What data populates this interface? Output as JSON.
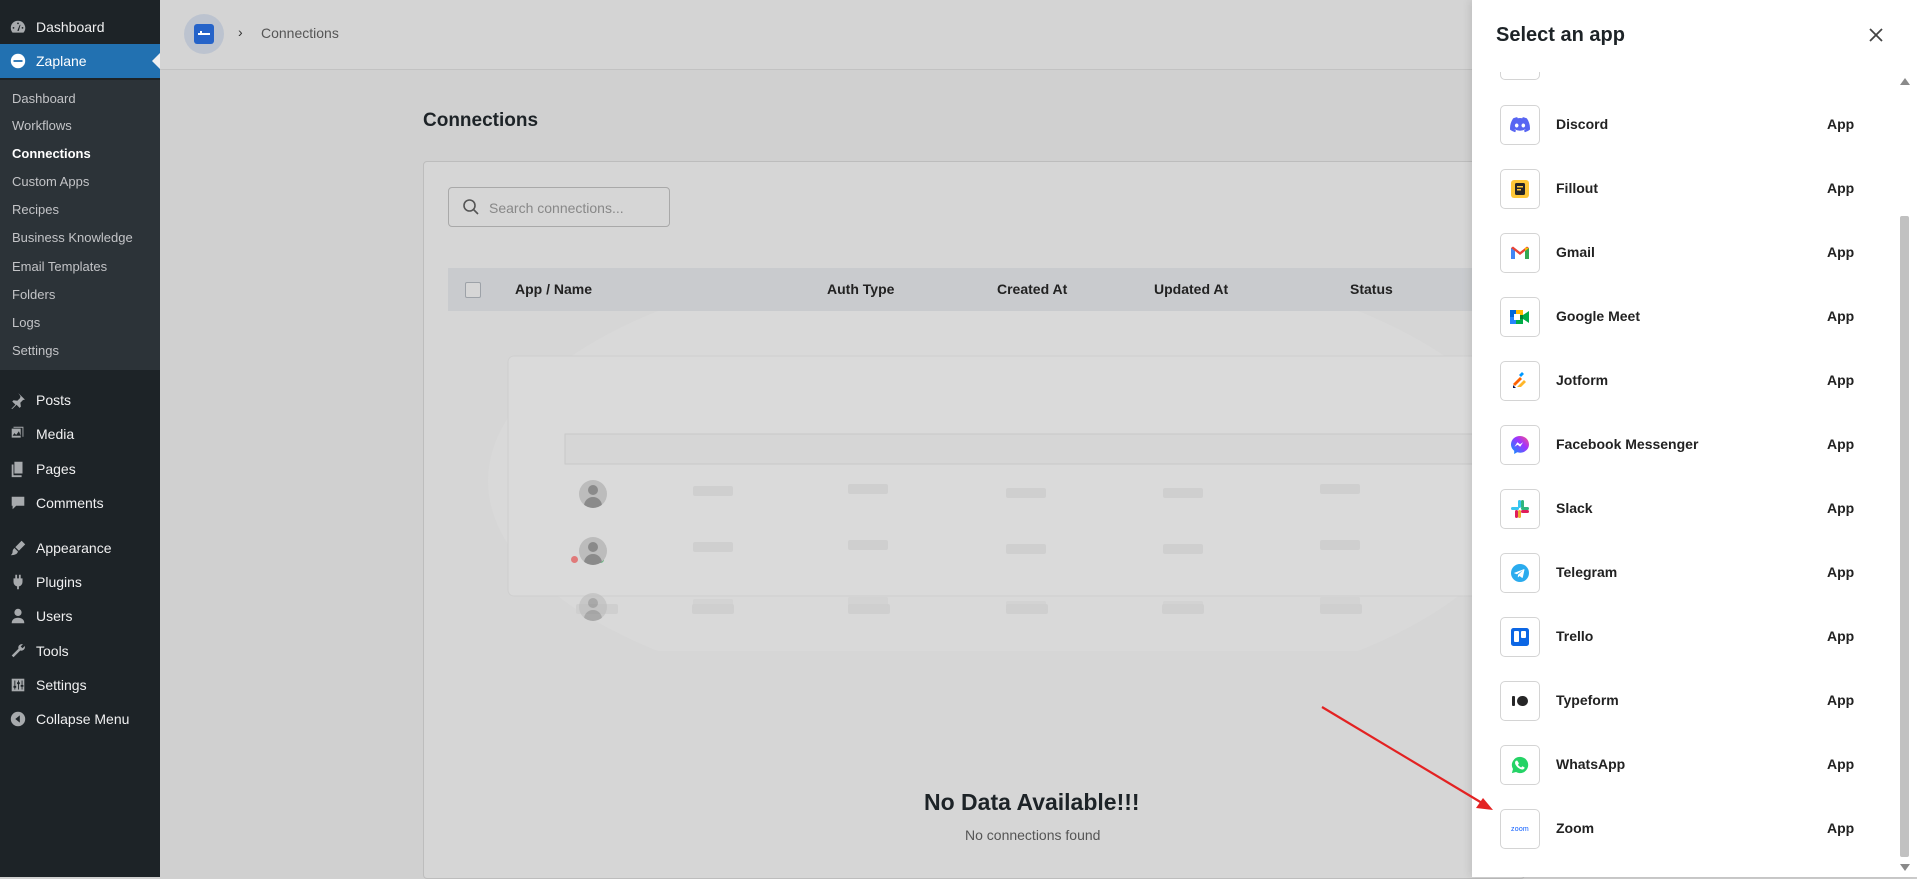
{
  "wp_menu": {
    "dashboard": "Dashboard",
    "zaplane": "Zaplane",
    "posts": "Posts",
    "media": "Media",
    "pages": "Pages",
    "comments": "Comments",
    "appearance": "Appearance",
    "plugins": "Plugins",
    "users": "Users",
    "tools": "Tools",
    "settings": "Settings",
    "collapse": "Collapse Menu"
  },
  "zaplane_submenu": {
    "dashboard": "Dashboard",
    "workflows": "Workflows",
    "connections": "Connections",
    "custom_apps": "Custom Apps",
    "recipes": "Recipes",
    "business_knowledge": "Business Knowledge",
    "email_templates": "Email Templates",
    "folders": "Folders",
    "logs": "Logs",
    "settings": "Settings"
  },
  "breadcrumb": {
    "current": "Connections"
  },
  "page": {
    "title": "Connections"
  },
  "search": {
    "placeholder": "Search connections..."
  },
  "table": {
    "headers": {
      "app_name": "App / Name",
      "auth_type": "Auth Type",
      "created_at": "Created At",
      "updated_at": "Updated At",
      "status": "Status"
    }
  },
  "empty_state": {
    "title": "No Data Available!!!",
    "subtitle": "No connections found"
  },
  "drawer": {
    "title": "Select an app",
    "apps": [
      {
        "name": "Discord",
        "type": "App",
        "icon": "discord-icon",
        "color": "#5865F2"
      },
      {
        "name": "Fillout",
        "type": "App",
        "icon": "fillout-icon",
        "color": "#FFC839"
      },
      {
        "name": "Gmail",
        "type": "App",
        "icon": "gmail-icon",
        "color": "#EA4335"
      },
      {
        "name": "Google Meet",
        "type": "App",
        "icon": "google-meet-icon",
        "color": "#00832D"
      },
      {
        "name": "Jotform",
        "type": "App",
        "icon": "jotform-icon",
        "color": "#FF6100"
      },
      {
        "name": "Facebook Messenger",
        "type": "App",
        "icon": "messenger-icon",
        "color": "#A033FF"
      },
      {
        "name": "Slack",
        "type": "App",
        "icon": "slack-icon",
        "color": "#4A154B"
      },
      {
        "name": "Telegram",
        "type": "App",
        "icon": "telegram-icon",
        "color": "#2AABEE"
      },
      {
        "name": "Trello",
        "type": "App",
        "icon": "trello-icon",
        "color": "#0C66E4"
      },
      {
        "name": "Typeform",
        "type": "App",
        "icon": "typeform-icon",
        "color": "#262627"
      },
      {
        "name": "WhatsApp",
        "type": "App",
        "icon": "whatsapp-icon",
        "color": "#25D366"
      },
      {
        "name": "Zoom",
        "type": "App",
        "icon": "zoom-icon",
        "color": "#0B5CFF",
        "icon_text": "zoom"
      }
    ]
  },
  "colors": {
    "wp_sidebar": "#1d2327",
    "wp_active": "#2271b1",
    "annotation_arrow": "#e32222"
  }
}
